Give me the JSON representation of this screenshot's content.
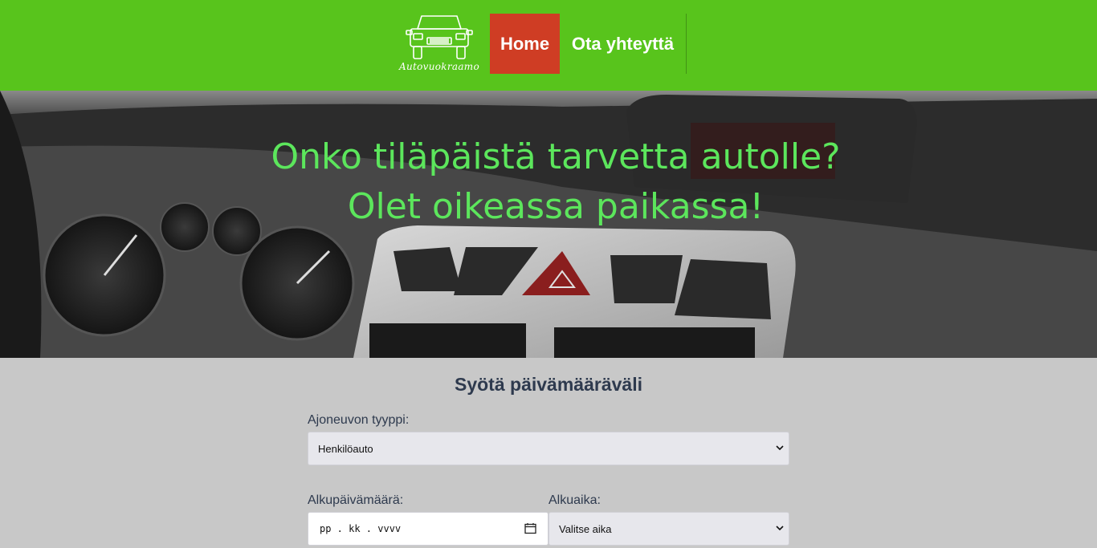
{
  "header": {
    "logo_text": "Autovuokraamo",
    "nav": {
      "home": "Home",
      "contact": "Ota yhteyttä"
    }
  },
  "hero": {
    "line1": "Onko tiläpäistä tarvetta autolle?",
    "line2": "Olet oikeassa paikassa!"
  },
  "form": {
    "title": "Syötä päivämääräväli",
    "vehicle_type": {
      "label": "Ajoneuvon tyyppi:",
      "value": "Henkilöauto"
    },
    "start_date": {
      "label": "Alkupäivämäärä:",
      "placeholder": "pp . kk . vvvv"
    },
    "start_time": {
      "label": "Alkuaika:",
      "value": "Valitse aika"
    }
  },
  "colors": {
    "header_bg": "#58c41c",
    "nav_active_bg": "#cf3d24",
    "hero_text": "#5ce65c",
    "page_bg": "#c8c8c8",
    "form_text": "#2e3a4e"
  }
}
